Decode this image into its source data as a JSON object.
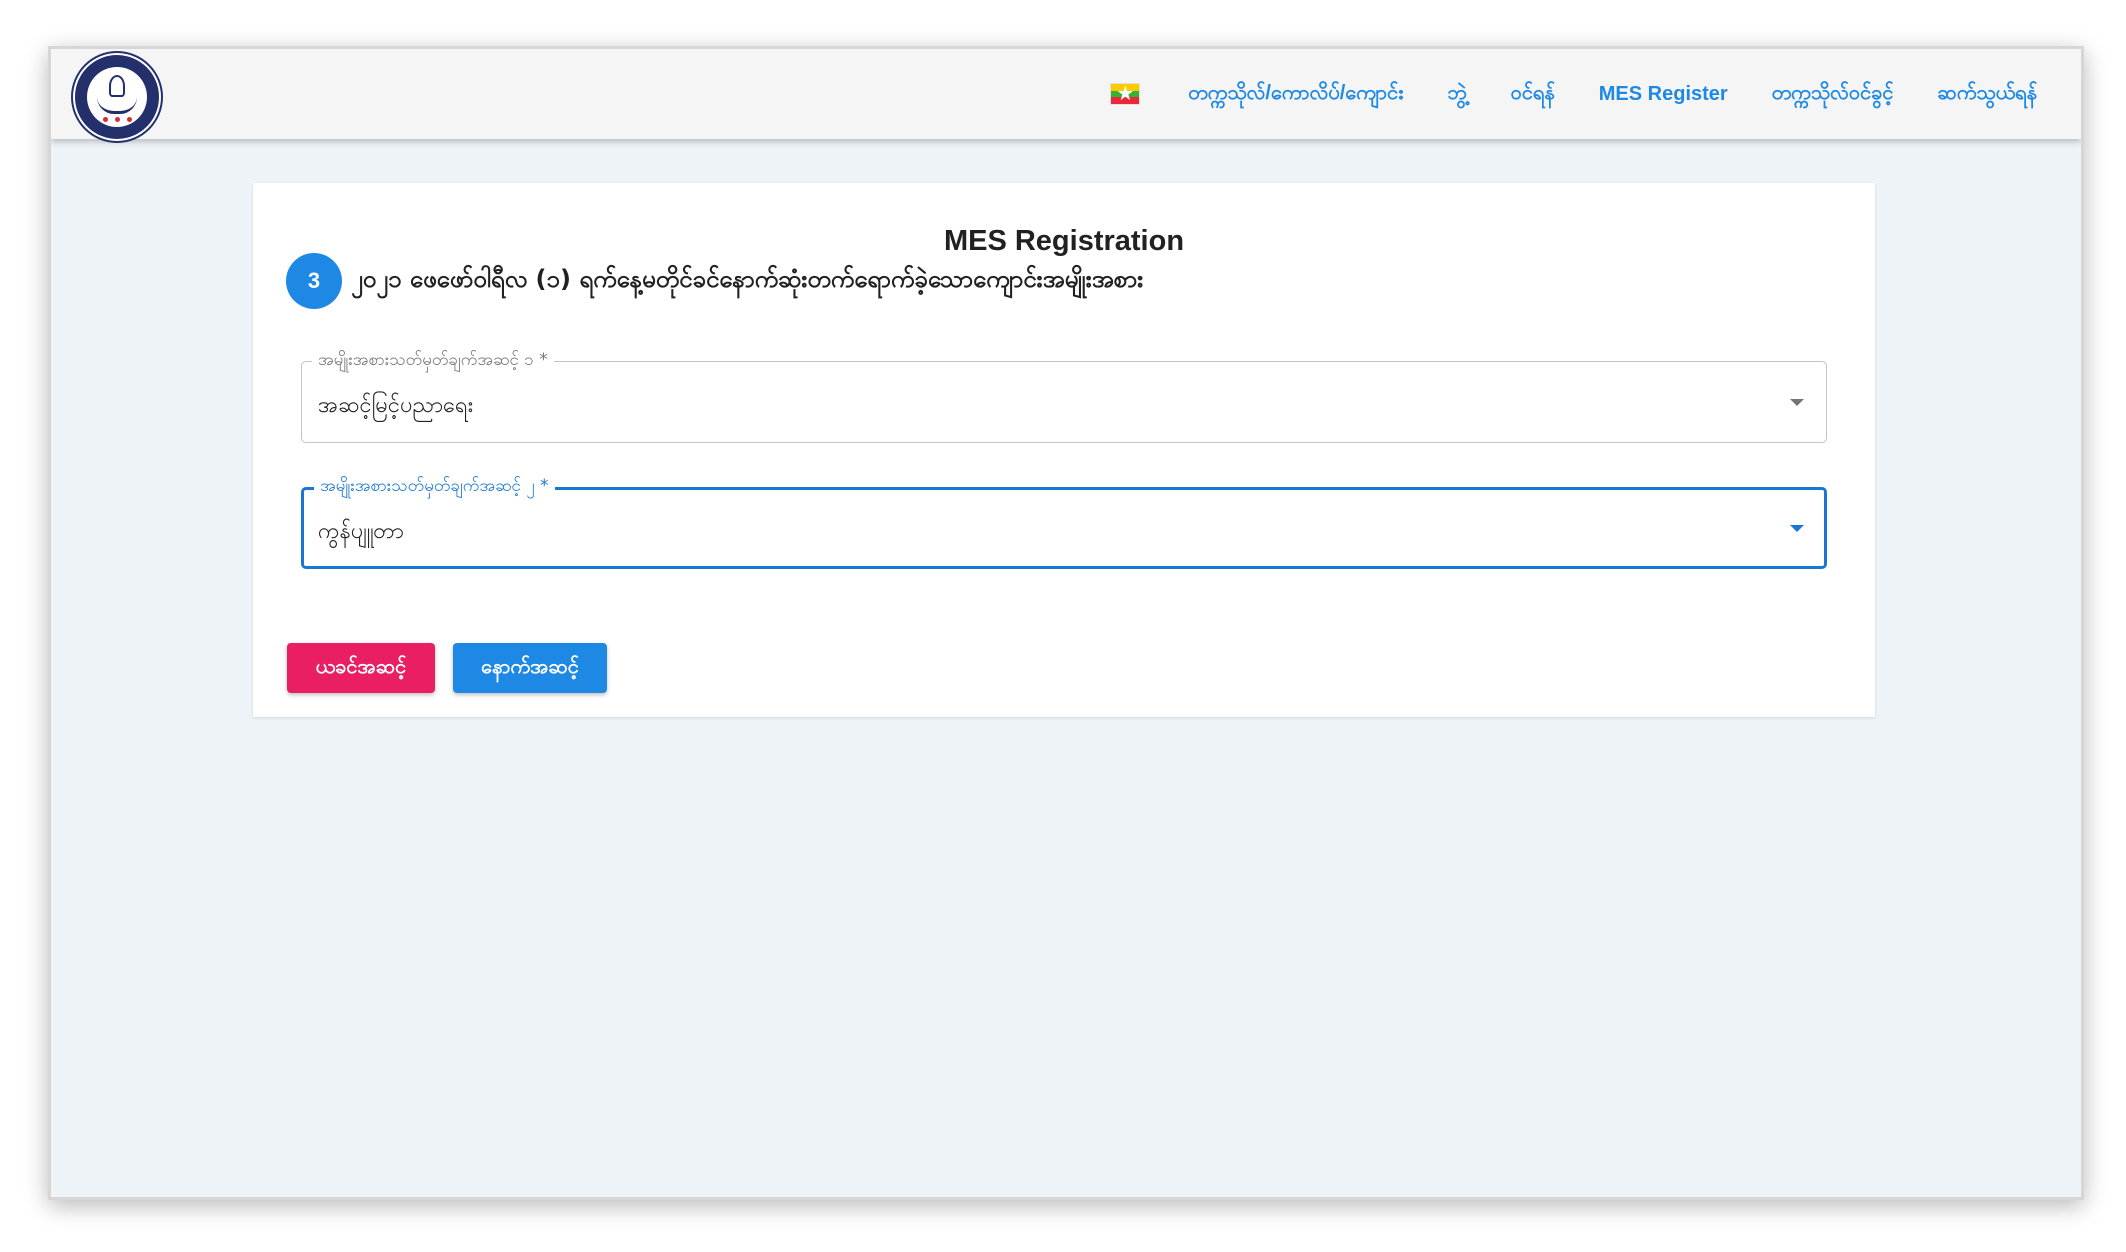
{
  "navbar": {
    "flag_icon": "myanmar-flag-icon",
    "links": [
      "တက္ကသိုလ်/ကောလိပ်/ကျောင်း",
      "ဘွဲ့",
      "ဝင်ရန်",
      "MES Register",
      "တက္ကသိုလ်ဝင်ခွင့်",
      "ဆက်သွယ်ရန်"
    ],
    "link_color": "#1e88e5"
  },
  "form": {
    "title": "MES Registration",
    "step_number": "3",
    "step_title": "၂၀၂၁ ဖေဖော်ဝါရီလ (၁) ရက်နေ့မတိုင်ခင်နောက်ဆုံးတက်ရောက်ခဲ့သောကျောင်းအမျိုးအစား",
    "field1": {
      "label": "အမျိုးအစားသတ်မှတ်ချက်အဆင့် ၁ *",
      "value": "အဆင့်မြင့်ပညာရေး"
    },
    "field2": {
      "label": "အမျိုးအစားသတ်မှတ်ချက်အဆင့် ၂ *",
      "value": "ကွန်ပျူတာ"
    },
    "back_button": "ယခင်အဆင့်",
    "next_button": "နောက်အဆင့်",
    "colors": {
      "primary": "#1e88e5",
      "back": "#e91e63",
      "focus": "#1976d2"
    }
  }
}
